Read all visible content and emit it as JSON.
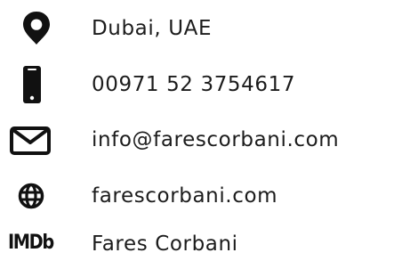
{
  "contact": {
    "items": [
      {
        "icon": "location-pin-icon",
        "text": "Dubai, UAE"
      },
      {
        "icon": "mobile-phone-icon",
        "text": "00971 52 3754617"
      },
      {
        "icon": "envelope-icon",
        "text": "info@farescorbani.com"
      },
      {
        "icon": "globe-icon",
        "text": "farescorbani.com"
      },
      {
        "icon": "imdb-icon",
        "text": "Fares Corbani",
        "icon_text": "IMDb"
      }
    ]
  },
  "colors": {
    "text": "#1c1c1c",
    "icon": "#111111"
  }
}
